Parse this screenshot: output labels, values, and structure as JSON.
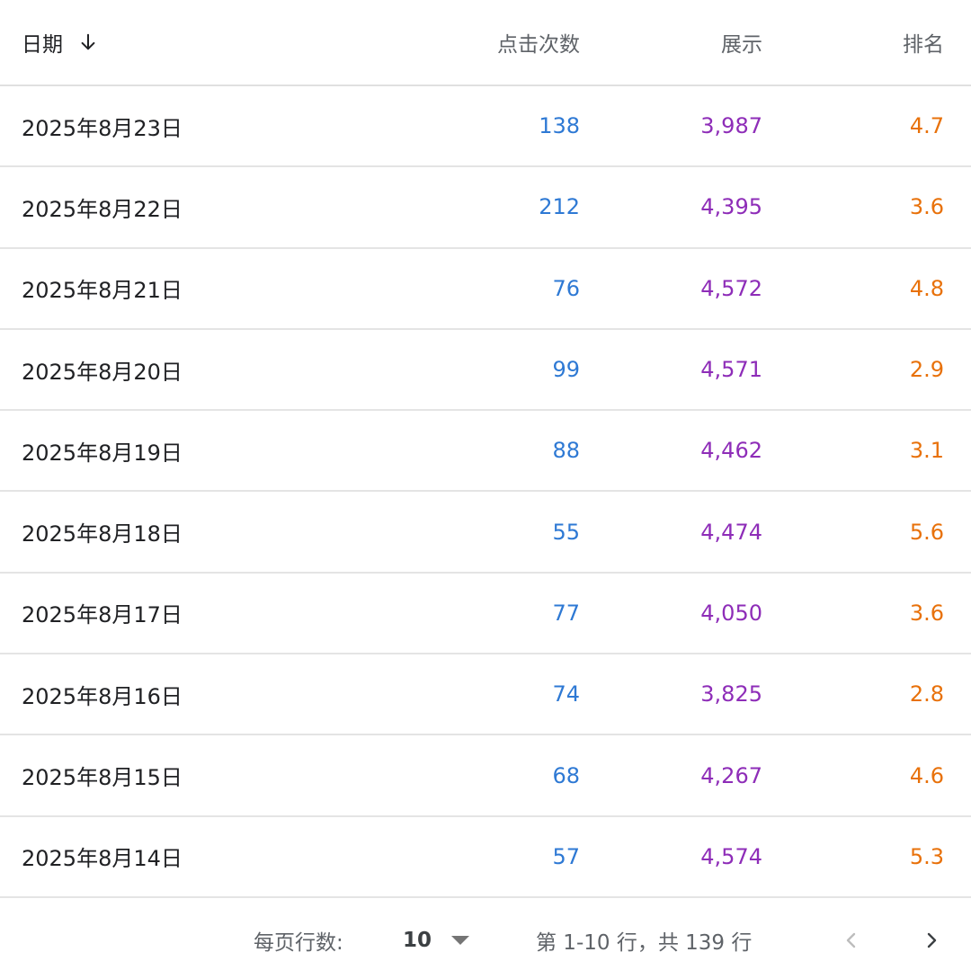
{
  "table": {
    "headers": {
      "date": "日期",
      "clicks": "点击次数",
      "impressions": "展示",
      "rank": "排名"
    },
    "sort": {
      "column": "date",
      "direction": "descending",
      "icon": "arrow-down-icon"
    },
    "rows": [
      {
        "date": "2025年8月23日",
        "clicks": "138",
        "impressions": "3,987",
        "rank": "4.7"
      },
      {
        "date": "2025年8月22日",
        "clicks": "212",
        "impressions": "4,395",
        "rank": "3.6"
      },
      {
        "date": "2025年8月21日",
        "clicks": "76",
        "impressions": "4,572",
        "rank": "4.8"
      },
      {
        "date": "2025年8月20日",
        "clicks": "99",
        "impressions": "4,571",
        "rank": "2.9"
      },
      {
        "date": "2025年8月19日",
        "clicks": "88",
        "impressions": "4,462",
        "rank": "3.1"
      },
      {
        "date": "2025年8月18日",
        "clicks": "55",
        "impressions": "4,474",
        "rank": "5.6"
      },
      {
        "date": "2025年8月17日",
        "clicks": "77",
        "impressions": "4,050",
        "rank": "3.6"
      },
      {
        "date": "2025年8月16日",
        "clicks": "74",
        "impressions": "3,825",
        "rank": "2.8"
      },
      {
        "date": "2025年8月15日",
        "clicks": "68",
        "impressions": "4,267",
        "rank": "4.6"
      },
      {
        "date": "2025年8月14日",
        "clicks": "57",
        "impressions": "4,574",
        "rank": "5.3"
      }
    ]
  },
  "pagination": {
    "rows_per_page_label": "每页行数:",
    "rows_per_page_value": "10",
    "range_text": "第 1-10 行，共 139 行",
    "prev_icon": "chevron-left-icon",
    "next_icon": "chevron-right-icon"
  },
  "colors": {
    "clicks": "#2e79d4",
    "impressions": "#8e2db8",
    "rank": "#e8710a",
    "divider": "#e0e0e0"
  }
}
